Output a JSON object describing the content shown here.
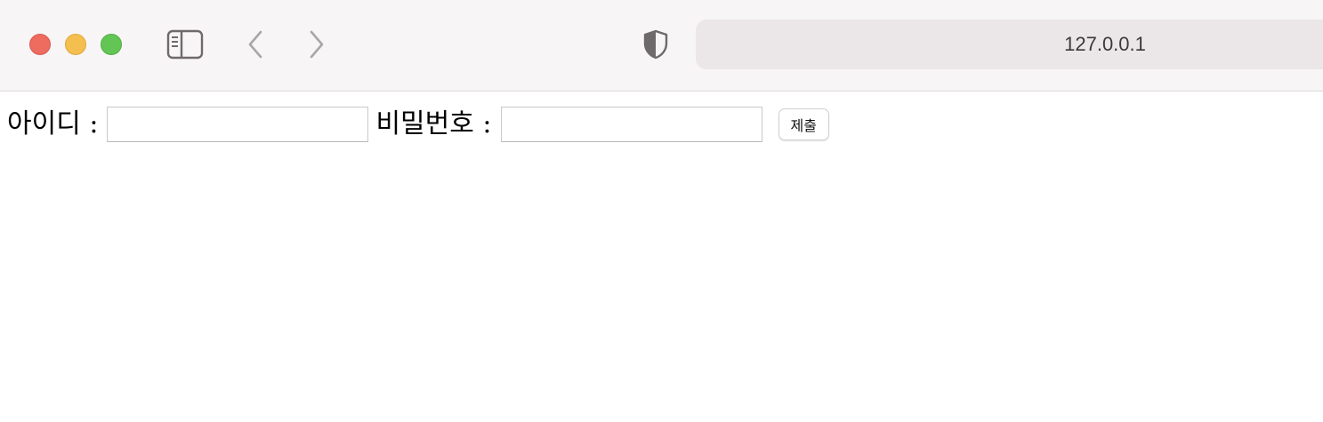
{
  "browser": {
    "address": "127.0.0.1",
    "icons": {
      "close": "close-button",
      "minimize": "minimize-button",
      "maximize": "maximize-button",
      "sidebar": "sidebar-icon",
      "back": "chevron-left-icon",
      "forward": "chevron-right-icon",
      "privacy": "shield-icon"
    },
    "colors": {
      "close": "#ee6b60",
      "minimize": "#f5bf4f",
      "maximize": "#62c554",
      "toolbar_bg": "#f8f5f6",
      "address_bg": "#ebe7e8"
    }
  },
  "form": {
    "id_label": "아이디 :",
    "id_value": "",
    "password_label": "비밀번호 :",
    "password_value": "",
    "submit_label": "제출"
  }
}
